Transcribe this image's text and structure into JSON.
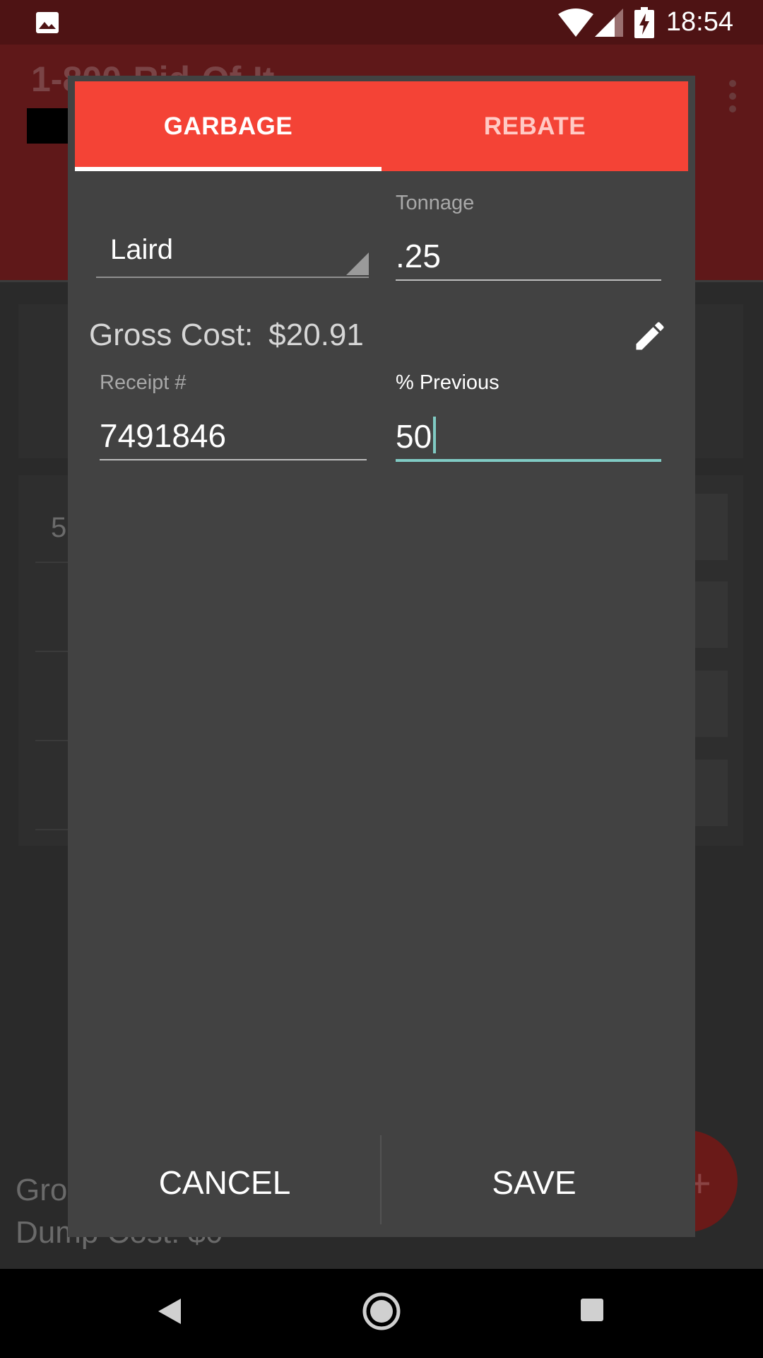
{
  "status_bar": {
    "time": "18:54",
    "icons": [
      "image-icon",
      "wifi-icon",
      "signal-icon",
      "battery-charging-icon"
    ]
  },
  "background_app": {
    "title": "1-800-Rid-Of-It",
    "card_number": "5",
    "bottom_line_1": "Gro",
    "bottom_line_2": "Dump Cost: $0"
  },
  "dialog": {
    "tabs": [
      {
        "label": "GARBAGE",
        "selected": true
      },
      {
        "label": "REBATE",
        "selected": false
      }
    ],
    "location_spinner": {
      "value": "Laird"
    },
    "tonnage": {
      "label": "Tonnage",
      "value": ".25"
    },
    "gross_cost": {
      "label": "Gross Cost:",
      "value": "$20.91"
    },
    "receipt": {
      "label": "Receipt #",
      "value": "7491846"
    },
    "percent_previous": {
      "label": "% Previous",
      "value": "50",
      "focused": true
    },
    "buttons": {
      "cancel": "CANCEL",
      "save": "SAVE"
    }
  },
  "colors": {
    "tab_bar": "#f44336",
    "dialog_bg": "#424242",
    "focus_accent": "#80cbc4",
    "status_bar": "#4e1314"
  }
}
